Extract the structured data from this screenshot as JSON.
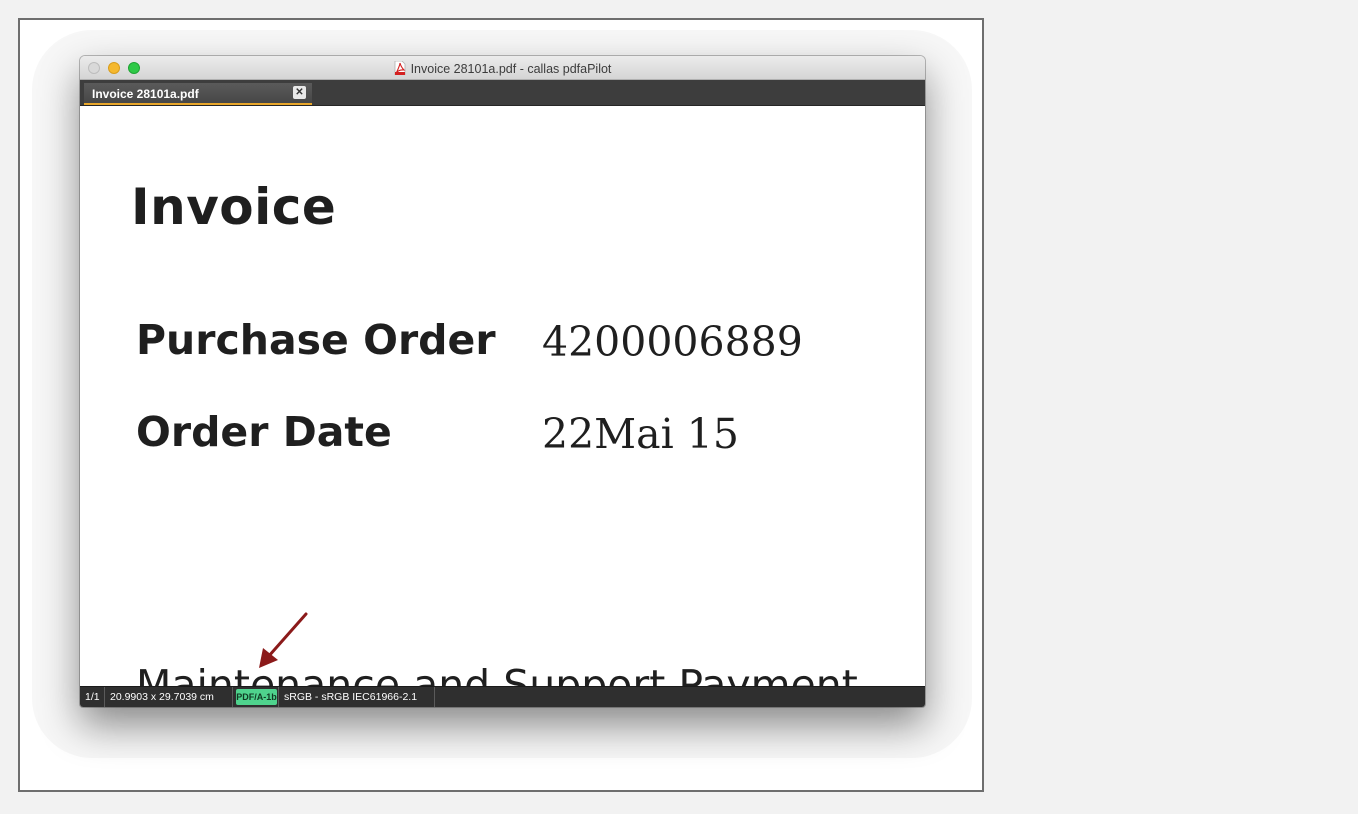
{
  "window": {
    "title": "Invoice 28101a.pdf - callas pdfaPilot",
    "tab_label": "Invoice 28101a.pdf",
    "tab_close_glyph": "✕"
  },
  "document": {
    "title": "Invoice",
    "purchase_order_label": "Purchase Order",
    "purchase_order_value": "4200006889",
    "order_date_label": "Order Date",
    "order_date_value": "22Mai 15",
    "section_heading": "Maintenance and Support Payment"
  },
  "status_bar": {
    "page_indicator": "1/1",
    "page_size": "20.9903 x 29.7039 cm",
    "conformance_badge": "PDF/A-1b",
    "color_profile": "sRGB - sRGB IEC61966-2.1"
  },
  "colors": {
    "accent_tab_underline": "#e8a62a",
    "badge_green": "#4fd38d",
    "annotation_arrow": "#8b1a1a"
  }
}
